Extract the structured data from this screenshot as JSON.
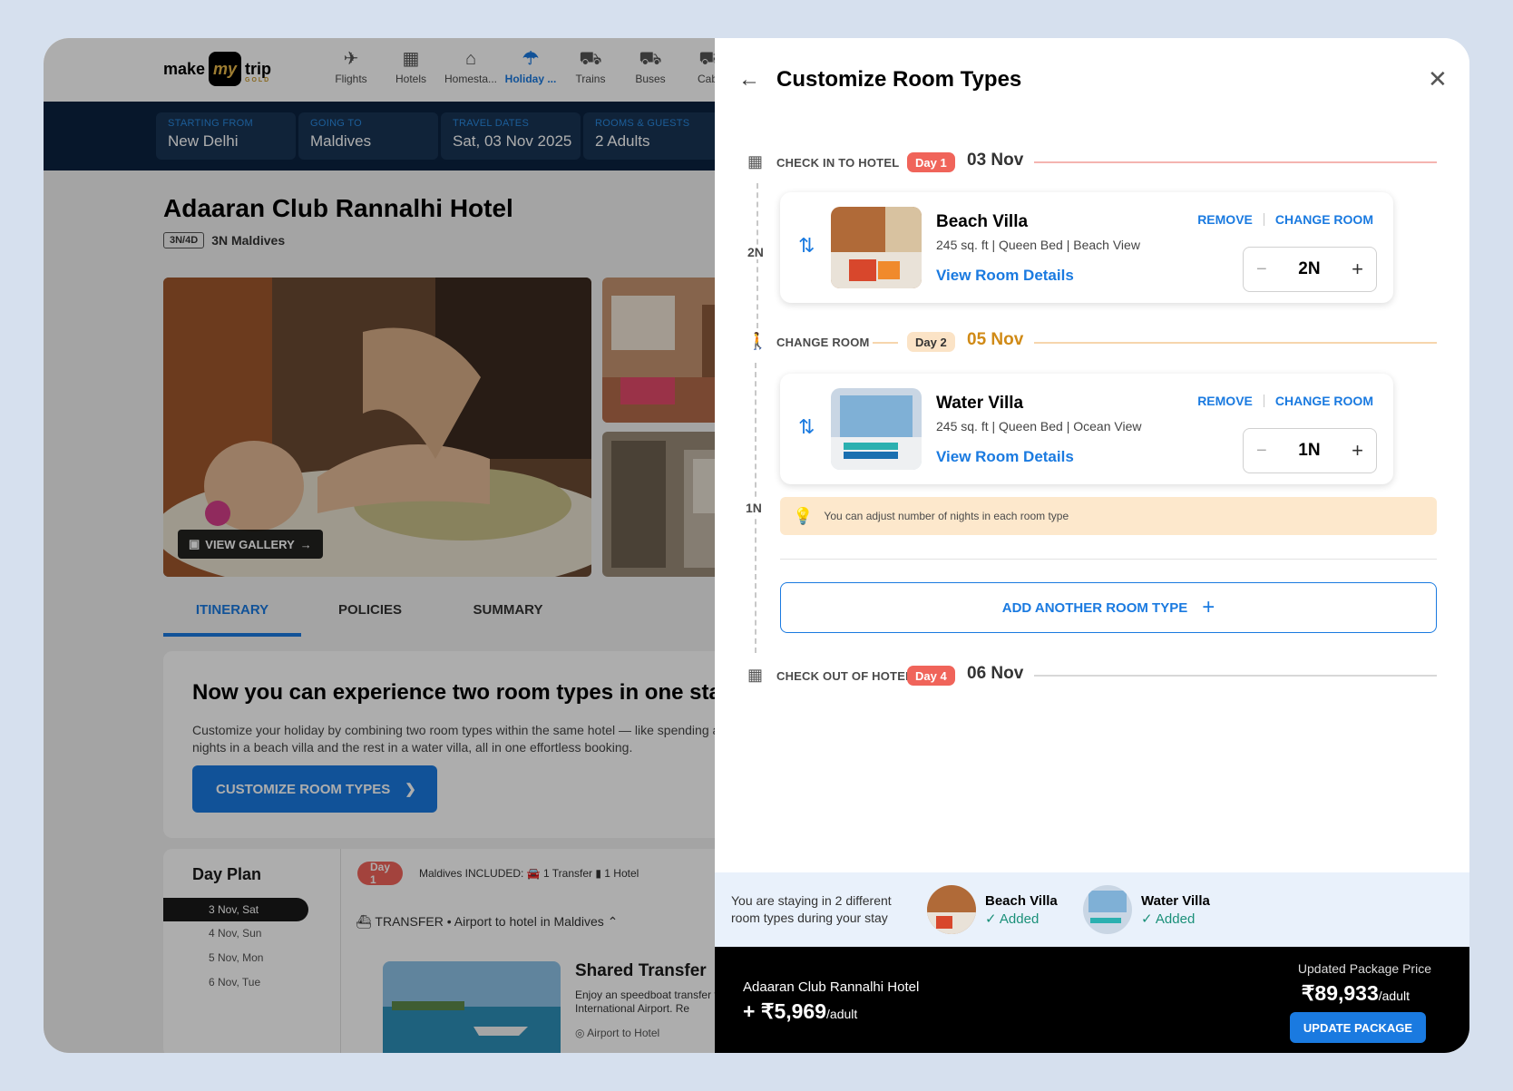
{
  "app": {
    "logo_prefix": "make",
    "logo_badge": "my",
    "logo_suffix": "trip",
    "logo_tier": "GOLD"
  },
  "nav": [
    {
      "label": "Flights",
      "icon": "plane-icon",
      "glyph": "✈"
    },
    {
      "label": "Hotels",
      "icon": "hotel-icon",
      "glyph": "▦"
    },
    {
      "label": "Homesta...",
      "icon": "homestay-icon",
      "glyph": "⌂"
    },
    {
      "label": "Holiday ...",
      "icon": "holiday-umbrella-icon",
      "glyph": "☂",
      "active": true
    },
    {
      "label": "Trains",
      "icon": "train-icon",
      "glyph": "⛟"
    },
    {
      "label": "Buses",
      "icon": "bus-icon",
      "glyph": "⛟"
    },
    {
      "label": "Cabs",
      "icon": "cab-icon",
      "glyph": "⛟"
    }
  ],
  "search": [
    {
      "label": "STARTING FROM",
      "value": "New Delhi"
    },
    {
      "label": "GOING TO",
      "value": "Maldives"
    },
    {
      "label": "TRAVEL DATES",
      "value": "Sat, 03 Nov 2025"
    },
    {
      "label": "ROOMS & GUESTS",
      "value": "2 Adults"
    }
  ],
  "hotel": {
    "name": "Adaaran Club Rannalhi Hotel",
    "nights_tag": "3N/4D",
    "nights_text": "3N Maldives",
    "gallery_label": "VIEW GALLERY"
  },
  "tabs": [
    "ITINERARY",
    "POLICIES",
    "SUMMARY"
  ],
  "promo": {
    "title": "Now you can experience two room types in one stay!",
    "description": "Customize your holiday by combining two room types within the same hotel — like spending a few nights in a beach villa and the rest in a water villa, all in one effortless booking.",
    "button": "CUSTOMIZE ROOM TYPES"
  },
  "dayplan": {
    "title": "Day Plan",
    "dates": [
      "3 Nov, Sat",
      "4 Nov, Sun",
      "5 Nov, Mon",
      "6 Nov, Tue"
    ],
    "day_pill": "Day 1",
    "included": "Maldives     INCLUDED:   🚘 1 Transfer   ▮ 1 Hotel",
    "transfer": "TRANSFER • Airport to hotel in Maldives",
    "shared_title": "Shared Transfer",
    "shared_desc_1": "Enjoy an speedboat transfer from",
    "shared_desc_2": "International Airport. Re",
    "shared_loc": "Airport to Hotel"
  },
  "modal": {
    "title": "Customize Room Types",
    "checkin": {
      "label": "CHECK IN TO HOTEL",
      "day": "Day 1",
      "date": "03 Nov"
    },
    "change": {
      "label": "CHANGE ROOM",
      "day": "Day 2",
      "date": "05 Nov"
    },
    "checkout": {
      "label": "CHECK OUT OF HOTEL",
      "day": "Day 4",
      "date": "06 Nov"
    },
    "night1": "2N",
    "night2": "1N",
    "remove_label": "REMOVE",
    "change_label": "CHANGE ROOM",
    "details_label": "View Room Details",
    "rooms": [
      {
        "name": "Beach Villa",
        "spec": "245 sq. ft | Queen Bed | Beach View",
        "nights": "2N"
      },
      {
        "name": "Water Villa",
        "spec": "245 sq. ft | Queen Bed | Ocean View",
        "nights": "1N"
      }
    ],
    "tip": "You can adjust number of nights in each room type",
    "add_room": "ADD ANOTHER ROOM TYPE"
  },
  "summary": {
    "text": "You are staying in 2 different room types during your stay",
    "added_label": "✓ Added",
    "rooms": [
      "Beach Villa",
      "Water Villa"
    ]
  },
  "footer": {
    "hotel": "Adaaran Club Rannalhi Hotel",
    "add_amount": "+ ₹5,969",
    "per": "/adult",
    "updated_label": "Updated Package Price",
    "updated_amount": "₹89,933",
    "button": "UPDATE PACKAGE"
  },
  "colors": {
    "accent": "#1a7ae0",
    "day_red": "#f0645a",
    "day_tan": "#fbe3c6",
    "added_green": "#1a9079",
    "tip_bg": "#fde8cc"
  }
}
